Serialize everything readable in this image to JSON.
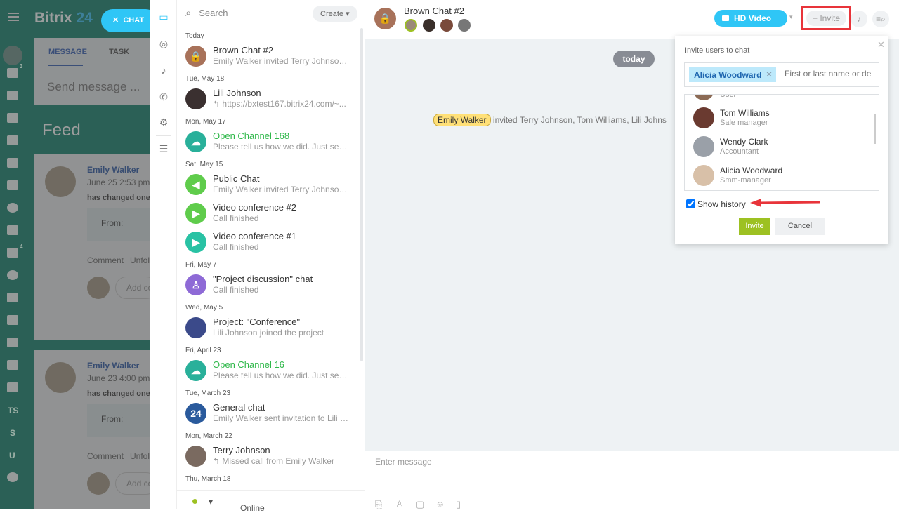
{
  "portal": {
    "logo_a": "Bitrix",
    "logo_b": "24",
    "chat_button": "CHAT",
    "tabs": [
      "MESSAGE",
      "TASK"
    ],
    "send_placeholder": "Send message ...",
    "feed_title": "Feed",
    "nav_badges": {
      "tasks": "3",
      "crm": "4"
    },
    "nav_text": [
      "TS",
      "S",
      "U"
    ],
    "posts": [
      {
        "author": "Emily Walker",
        "date": "June 25 2:53 pm",
        "text": "has changed one",
        "from": "From:",
        "comment": "Comment",
        "unfollow": "Unfol",
        "add_comment": "Add co"
      },
      {
        "author": "Emily Walker",
        "date": "June 23 4:00 pm",
        "text": "has changed one",
        "from": "From:",
        "comment": "Comment",
        "unfollow": "Unfol",
        "add_comment": "Add co"
      }
    ]
  },
  "chatlist": {
    "search_placeholder": "Search",
    "create": "Create",
    "groups": [
      {
        "date": "Today",
        "items": [
          {
            "title": "Brown Chat #2",
            "subtitle": "Emily Walker invited Terry Johnson...",
            "icon": "lock",
            "color": "#a8725a"
          }
        ]
      },
      {
        "date": "Tue, May 18",
        "items": [
          {
            "title": "Lili Johnson",
            "subtitle": "↰ https://bxtest167.bitrix24.com/~...",
            "icon": "avatar",
            "color": "#3a3030"
          }
        ]
      },
      {
        "date": "Mon, May 17",
        "items": [
          {
            "title": "Open Channel 168",
            "subtitle": "Please tell us how we did. Just sen...",
            "icon": "cloud",
            "color": "#29b09a",
            "green": true
          }
        ]
      },
      {
        "date": "Sat, May 15",
        "items": [
          {
            "title": "Public Chat",
            "subtitle": "Emily Walker invited Terry Johnson...",
            "icon": "megaphone",
            "color": "#5fcc4b"
          },
          {
            "title": "Video conference #2",
            "subtitle": "Call finished",
            "icon": "video",
            "color": "#5fcc4b"
          },
          {
            "title": "Video conference #1",
            "subtitle": "Call finished",
            "icon": "video",
            "color": "#29c2a4"
          }
        ]
      },
      {
        "date": "Fri, May 7",
        "items": [
          {
            "title": "\"Project discussion\" chat",
            "subtitle": "Call finished",
            "icon": "user",
            "color": "#8e6ad6"
          }
        ]
      },
      {
        "date": "Wed, May 5",
        "items": [
          {
            "title": "Project: \"Conference\"",
            "subtitle": "Lili Johnson joined the project",
            "icon": "avatar",
            "color": "#3b4a8a"
          }
        ]
      },
      {
        "date": "Fri, April 23",
        "items": [
          {
            "title": "Open Channel 16",
            "subtitle": "Please tell us how we did. Just sen...",
            "icon": "cloud",
            "color": "#29b09a",
            "green": true
          }
        ]
      },
      {
        "date": "Tue, March 23",
        "items": [
          {
            "title": "General chat",
            "subtitle": "Emily Walker sent invitation to Lili J...",
            "icon": "24",
            "color": "#2a5a9c"
          }
        ]
      },
      {
        "date": "Mon, March 22",
        "items": [
          {
            "title": "Terry Johnson",
            "subtitle": "↰ Missed call from Emily Walker",
            "icon": "avatar",
            "color": "#7a6a60"
          }
        ]
      },
      {
        "date": "Thu, March 18",
        "items": []
      }
    ],
    "status": "Online"
  },
  "chat": {
    "title": "Brown Chat #2",
    "video_call": "HD Video call",
    "invite": "+ Invite",
    "today": "today",
    "system_author": "Emily Walker",
    "system_text": "invited Terry Johnson, Tom Williams, Lili Johns",
    "input_placeholder": "Enter message"
  },
  "invite_popup": {
    "title": "Invite users to chat",
    "selected_tag": "Alicia Woodward",
    "input_placeholder": "First or last name or de",
    "users": [
      {
        "name": "",
        "role": "User"
      },
      {
        "name": "Tom Williams",
        "role": "Sale manager"
      },
      {
        "name": "Wendy Clark",
        "role": "Accountant"
      },
      {
        "name": "Alicia Woodward",
        "role": "Smm-manager"
      }
    ],
    "show_history": "Show history",
    "show_history_checked": true,
    "invite_button": "Invite",
    "cancel_button": "Cancel"
  },
  "colors": {
    "accent": "#2fc6f6",
    "invite_green": "#9dc122",
    "highlight_red": "#e8343a"
  }
}
